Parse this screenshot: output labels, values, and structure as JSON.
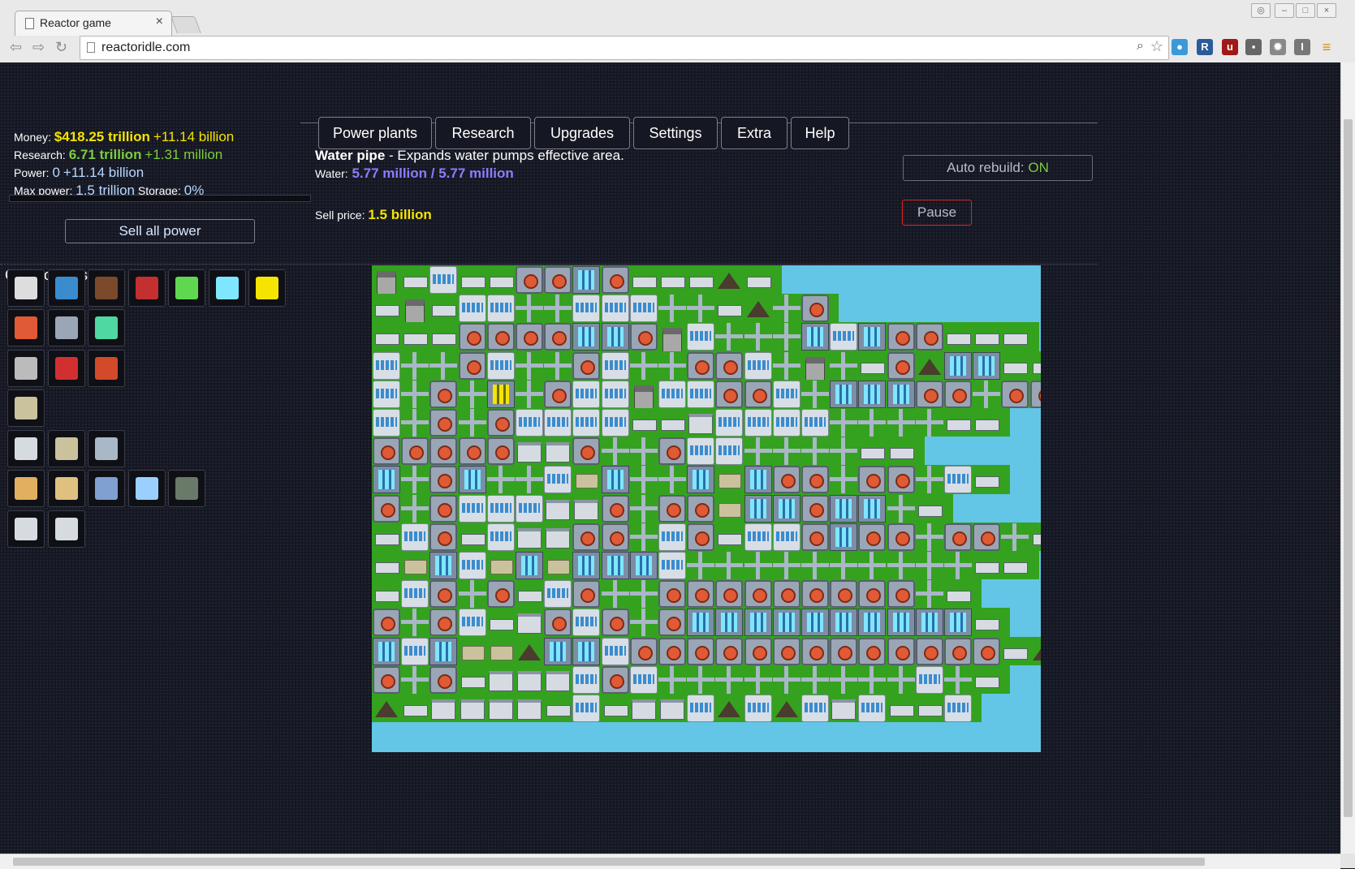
{
  "browser": {
    "tab_title": "Reactor game",
    "url": "reactoridle.com"
  },
  "stats": {
    "money_label": "Money:",
    "money_value": "$418.25 trillion",
    "money_rate": "+11.14 billion",
    "research_label": "Research:",
    "research_value": "6.71 trillion",
    "research_rate": "+1.31 million",
    "power_label": "Power:",
    "power_value": "0",
    "power_rate": "+11.14 billion",
    "maxpower_label": "Max power:",
    "maxpower_value": "1.5 trillion",
    "storage_label": "Storage:",
    "storage_value": "0%",
    "power_fill": 0
  },
  "sell_all_label": "Sell all power",
  "components_title": "Components",
  "tabs": [
    "Power plants",
    "Research",
    "Upgrades",
    "Settings",
    "Extra",
    "Help"
  ],
  "info": {
    "name": "Water pipe",
    "description": "- Expands water pumps effective area.",
    "water_label": "Water:",
    "water_value": "5.77 million / 5.77 million",
    "sell_label": "Sell price:",
    "sell_value": "1.5 billion"
  },
  "auto_rebuild_label": "Auto rebuild:",
  "auto_rebuild_state": "ON",
  "pause_label": "Pause",
  "grid_rows": [
    "sthttrrcrtttmt",
    "tsthhpphhhpptmpr",
    "tttrrrrccrshpppchcrrttt",
    "hpprhpprhpprrhpsptrmccttt",
    "hprpyprhhshhrrhpcccrrprrttm",
    "hprprhhhhttwhhhhpppptt",
    "rrrrrwwrpprhhpppptt",
    "cprcpphbcppcbcrrprrpht",
    "rprhhhwwrprrbccrccpt",
    "thrthwwrrphrthhrcrrprrpt",
    "tbchbcbccchpppppppppptt",
    "thrprthrpprrrrrrrrrpt",
    "rprhtwrhrprcccccccccct",
    "chcbbmcchrrrrrrrrrrrrrtm",
    "rprtwwwhrhppppppppphpt",
    "mtwwwwthtwwhmhmhwhtth"
  ],
  "component_icons": [
    [
      "wind-turbine-icon",
      "solar-panel-icon",
      "coal-plant-icon",
      "gas-plant-icon",
      "uranium-cell-icon",
      "thorium-cell-icon",
      "plutonium-cell-icon"
    ],
    [
      "heat-exchanger-icon",
      "heat-vent-icon",
      "heat-inlet-icon"
    ],
    [
      "capacitor-icon",
      "battery-icon",
      "battery-plus-icon"
    ],
    [
      "storage-icon"
    ],
    [
      "water-pump-icon",
      "ground-pump-icon",
      "water-pipe-icon"
    ],
    [
      "house-icon",
      "office-icon",
      "factory-icon",
      "hospital-icon",
      "bank-icon"
    ],
    [
      "large-office-icon",
      "skyscraper-icon"
    ]
  ]
}
